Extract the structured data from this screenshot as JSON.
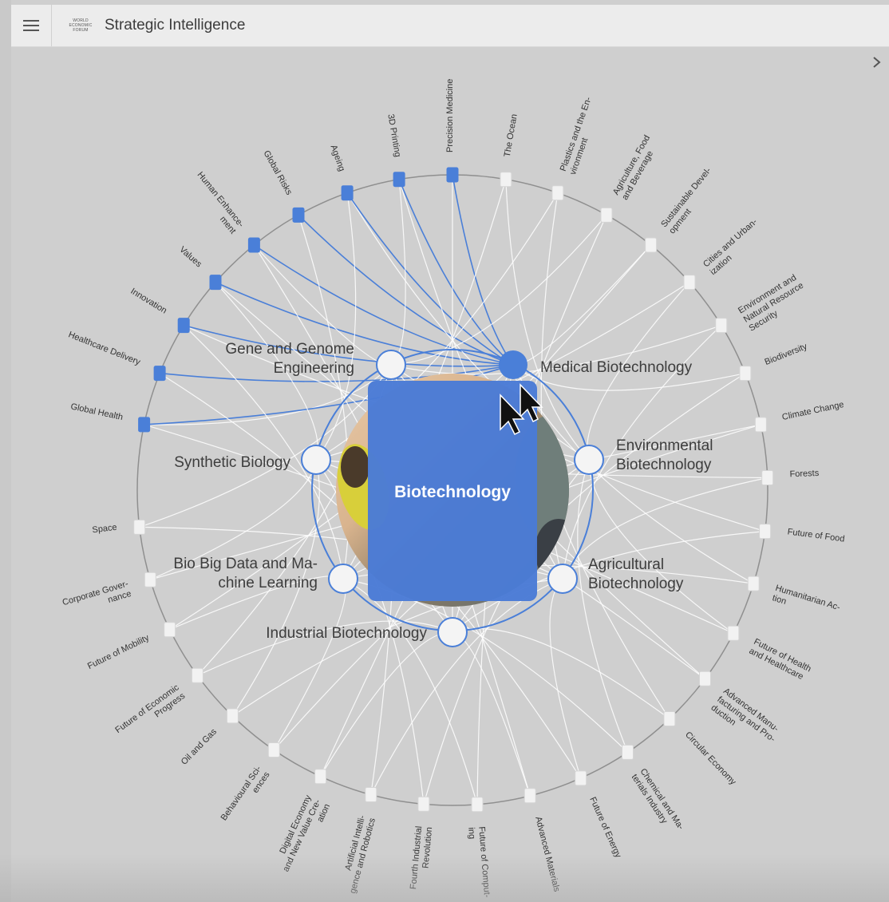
{
  "app": {
    "title": "Strategic Intelligence",
    "logo_lines": [
      "World",
      "Economic",
      "Forum"
    ]
  },
  "icons": {
    "menu": "hamburger-menu-icon",
    "panel_toggle": "chevron-right-icon",
    "cursor": "mouse-pointer-icon"
  },
  "colors": {
    "accent": "#4a7fd8",
    "card": "#4a7bd6",
    "ring": "#8f8f8f",
    "link": "#ffffff"
  },
  "graph": {
    "center": {
      "label": "Biotechnology"
    },
    "subtopics": [
      {
        "id": "gene",
        "label": [
          "Gene and Genome",
          "Engineering"
        ]
      },
      {
        "id": "med",
        "label": [
          "Medical Biotechnology"
        ],
        "selected": true
      },
      {
        "id": "env",
        "label": [
          "Environmental",
          "Biotechnology"
        ]
      },
      {
        "id": "agri",
        "label": [
          "Agricultural",
          "Biotechnology"
        ]
      },
      {
        "id": "ind",
        "label": [
          "Industrial Biotechnology"
        ]
      },
      {
        "id": "bigd",
        "label": [
          "Bio Big Data and Ma-",
          "chine Learning"
        ]
      },
      {
        "id": "synb",
        "label": [
          "Synthetic Biology"
        ]
      }
    ],
    "topics": [
      {
        "label": [
          "Global Health"
        ],
        "highlighted": true
      },
      {
        "label": [
          "Healthcare Delivery"
        ],
        "highlighted": true
      },
      {
        "label": [
          "Innovation"
        ],
        "highlighted": true
      },
      {
        "label": [
          "Values"
        ],
        "highlighted": true
      },
      {
        "label": [
          "Human Enhance-",
          "ment"
        ],
        "highlighted": true
      },
      {
        "label": [
          "Global Risks"
        ],
        "highlighted": true
      },
      {
        "label": [
          "Ageing"
        ],
        "highlighted": true
      },
      {
        "label": [
          "3D Printing"
        ],
        "highlighted": true
      },
      {
        "label": [
          "Precision Medicine"
        ],
        "highlighted": true
      },
      {
        "label": [
          "The Ocean"
        ]
      },
      {
        "label": [
          "Plastics and the En-",
          "vironment"
        ]
      },
      {
        "label": [
          "Agriculture, Food",
          "and Beverage"
        ]
      },
      {
        "label": [
          "Sustainable Devel-",
          "opment"
        ]
      },
      {
        "label": [
          "Cities and Urban-",
          "ization"
        ]
      },
      {
        "label": [
          "Environment and",
          "Natural Resource",
          "Security"
        ]
      },
      {
        "label": [
          "Biodiversity"
        ]
      },
      {
        "label": [
          "Climate Change"
        ]
      },
      {
        "label": [
          "Forests"
        ]
      },
      {
        "label": [
          "Future of Food"
        ]
      },
      {
        "label": [
          "Humanitarian Ac-",
          "tion"
        ]
      },
      {
        "label": [
          "Future of Health",
          "and Healthcare"
        ]
      },
      {
        "label": [
          "Advanced Manu-",
          "facturing and Pro-",
          "duction"
        ]
      },
      {
        "label": [
          "Circular Economy"
        ]
      },
      {
        "label": [
          "Chemical and Ma-",
          "terials Industry"
        ]
      },
      {
        "label": [
          "Future of Energy"
        ]
      },
      {
        "label": [
          "Advanced Materials"
        ]
      },
      {
        "label": [
          "Future of Comput-",
          "ing"
        ]
      },
      {
        "label": [
          "Fourth Industrial",
          "Revolution"
        ]
      },
      {
        "label": [
          "Artificial Intelli-",
          "gence and Robotics"
        ]
      },
      {
        "label": [
          "Digital Economy",
          "and New Value Cre-",
          "ation"
        ]
      },
      {
        "label": [
          "Behavioural Sci-",
          "ences"
        ]
      },
      {
        "label": [
          "Oil and Gas"
        ]
      },
      {
        "label": [
          "Future of Economic",
          "Progress"
        ]
      },
      {
        "label": [
          "Future of Mobility"
        ]
      },
      {
        "label": [
          "Corporate Gover-",
          "nance"
        ]
      },
      {
        "label": [
          "Space"
        ]
      }
    ]
  }
}
